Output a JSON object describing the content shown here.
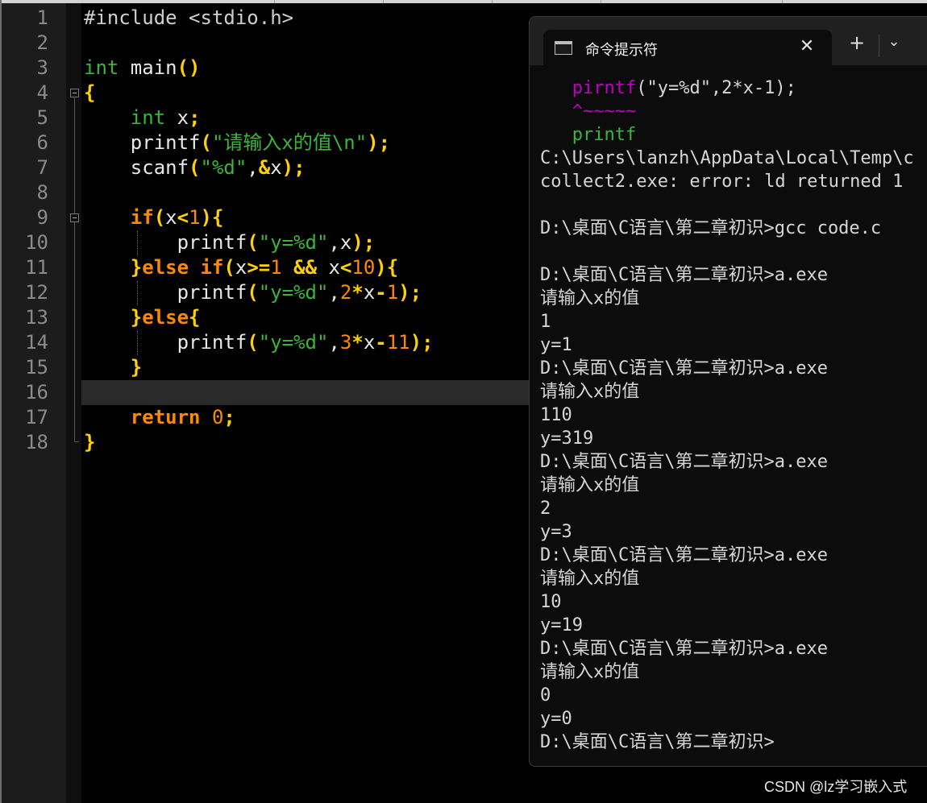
{
  "editor": {
    "lines": [
      {
        "n": "1",
        "tokens": [
          [
            "pp",
            "#include <stdio.h>"
          ]
        ]
      },
      {
        "n": "2",
        "tokens": []
      },
      {
        "n": "3",
        "tokens": [
          [
            "kw",
            "int"
          ],
          [
            "tx",
            " main"
          ],
          [
            "br",
            "()"
          ]
        ]
      },
      {
        "n": "4",
        "tokens": [
          [
            "br",
            "{"
          ]
        ]
      },
      {
        "n": "5",
        "tokens": [
          [
            "tx",
            "    "
          ],
          [
            "kw",
            "int"
          ],
          [
            "tx",
            " x"
          ],
          [
            "br",
            ";"
          ]
        ]
      },
      {
        "n": "6",
        "tokens": [
          [
            "tx",
            "    printf"
          ],
          [
            "br",
            "("
          ],
          [
            "st",
            "\"请输入x的值\\n\""
          ],
          [
            "br",
            ");"
          ]
        ]
      },
      {
        "n": "7",
        "tokens": [
          [
            "tx",
            "    scanf"
          ],
          [
            "br",
            "("
          ],
          [
            "st",
            "\"%d\""
          ],
          [
            "tx",
            ","
          ],
          [
            "br",
            "&"
          ],
          [
            "tx",
            "x"
          ],
          [
            "br",
            ");"
          ]
        ]
      },
      {
        "n": "8",
        "tokens": []
      },
      {
        "n": "9",
        "tokens": [
          [
            "tx",
            "    "
          ],
          [
            "kb",
            "if"
          ],
          [
            "br",
            "("
          ],
          [
            "tx",
            "x"
          ],
          [
            "br",
            "<"
          ],
          [
            "nm",
            "1"
          ],
          [
            "br",
            "){"
          ]
        ]
      },
      {
        "n": "10",
        "tokens": [
          [
            "tx",
            "        printf"
          ],
          [
            "br",
            "("
          ],
          [
            "st",
            "\"y=%d\""
          ],
          [
            "tx",
            ",x"
          ],
          [
            "br",
            ");"
          ]
        ]
      },
      {
        "n": "11",
        "tokens": [
          [
            "tx",
            "    "
          ],
          [
            "br",
            "}"
          ],
          [
            "kb",
            "else if"
          ],
          [
            "br",
            "("
          ],
          [
            "tx",
            "x"
          ],
          [
            "br",
            ">="
          ],
          [
            "nm",
            "1"
          ],
          [
            "tx",
            " "
          ],
          [
            "br",
            "&&"
          ],
          [
            "tx",
            " x"
          ],
          [
            "br",
            "<"
          ],
          [
            "nm",
            "10"
          ],
          [
            "br",
            "){"
          ]
        ]
      },
      {
        "n": "12",
        "tokens": [
          [
            "tx",
            "        printf"
          ],
          [
            "br",
            "("
          ],
          [
            "st",
            "\"y=%d\""
          ],
          [
            "tx",
            ","
          ],
          [
            "nm",
            "2"
          ],
          [
            "br",
            "*"
          ],
          [
            "tx",
            "x"
          ],
          [
            "br",
            "-"
          ],
          [
            "nm",
            "1"
          ],
          [
            "br",
            ");"
          ]
        ]
      },
      {
        "n": "13",
        "tokens": [
          [
            "tx",
            "    "
          ],
          [
            "br",
            "}"
          ],
          [
            "kb",
            "else"
          ],
          [
            "br",
            "{"
          ]
        ]
      },
      {
        "n": "14",
        "tokens": [
          [
            "tx",
            "        printf"
          ],
          [
            "br",
            "("
          ],
          [
            "st",
            "\"y=%d\""
          ],
          [
            "tx",
            ","
          ],
          [
            "nm",
            "3"
          ],
          [
            "br",
            "*"
          ],
          [
            "tx",
            "x"
          ],
          [
            "br",
            "-"
          ],
          [
            "nm",
            "11"
          ],
          [
            "br",
            ");"
          ]
        ]
      },
      {
        "n": "15",
        "tokens": [
          [
            "tx",
            "    "
          ],
          [
            "br",
            "}"
          ]
        ]
      },
      {
        "n": "16",
        "tokens": []
      },
      {
        "n": "17",
        "tokens": [
          [
            "tx",
            "    "
          ],
          [
            "kb",
            "return"
          ],
          [
            "tx",
            " "
          ],
          [
            "nm",
            "0"
          ],
          [
            "br",
            ";"
          ]
        ]
      },
      {
        "n": "18",
        "tokens": [
          [
            "br",
            "}"
          ]
        ]
      }
    ]
  },
  "terminal": {
    "tab_title": "命令提示符",
    "close_symbol": "✕",
    "plus_symbol": "+",
    "dropdown_symbol": "⌄",
    "lines": [
      [
        [
          "mag",
          "   pirntf"
        ],
        [
          "tx",
          "(\"y=%d\",2*x-1);"
        ]
      ],
      [
        [
          "mag",
          "   ^~~~~~"
        ]
      ],
      [
        [
          "grn",
          "   printf"
        ]
      ],
      [
        [
          "tx",
          "C:\\Users\\lanzh\\AppData\\Local\\Temp\\c"
        ]
      ],
      [
        [
          "tx",
          "collect2.exe: error: ld returned 1"
        ]
      ],
      [
        [
          "tx",
          ""
        ]
      ],
      [
        [
          "tx",
          "D:\\桌面\\C语言\\第二章初识>gcc code.c"
        ]
      ],
      [
        [
          "tx",
          ""
        ]
      ],
      [
        [
          "tx",
          "D:\\桌面\\C语言\\第二章初识>a.exe"
        ]
      ],
      [
        [
          "tx",
          "请输入x的值"
        ]
      ],
      [
        [
          "tx",
          "1"
        ]
      ],
      [
        [
          "tx",
          "y=1"
        ]
      ],
      [
        [
          "tx",
          "D:\\桌面\\C语言\\第二章初识>a.exe"
        ]
      ],
      [
        [
          "tx",
          "请输入x的值"
        ]
      ],
      [
        [
          "tx",
          "110"
        ]
      ],
      [
        [
          "tx",
          "y=319"
        ]
      ],
      [
        [
          "tx",
          "D:\\桌面\\C语言\\第二章初识>a.exe"
        ]
      ],
      [
        [
          "tx",
          "请输入x的值"
        ]
      ],
      [
        [
          "tx",
          "2"
        ]
      ],
      [
        [
          "tx",
          "y=3"
        ]
      ],
      [
        [
          "tx",
          "D:\\桌面\\C语言\\第二章初识>a.exe"
        ]
      ],
      [
        [
          "tx",
          "请输入x的值"
        ]
      ],
      [
        [
          "tx",
          "10"
        ]
      ],
      [
        [
          "tx",
          "y=19"
        ]
      ],
      [
        [
          "tx",
          "D:\\桌面\\C语言\\第二章初识>a.exe"
        ]
      ],
      [
        [
          "tx",
          "请输入x的值"
        ]
      ],
      [
        [
          "tx",
          "0"
        ]
      ],
      [
        [
          "tx",
          "y=0"
        ]
      ],
      [
        [
          "tx",
          "D:\\桌面\\C语言\\第二章初识>"
        ]
      ]
    ]
  },
  "watermark": "CSDN @lz学习嵌入式",
  "colors": {
    "editor_bg": "#000000",
    "gutter_bg": "#1c1c1c",
    "keyword_type": "#3ab53a",
    "keyword_control": "#ff8a00",
    "bracket": "#ffd100",
    "string": "#3ab53a",
    "number": "#ff8a00",
    "terminal_bg": "#0c0c0c",
    "terminal_error": "#c000c0",
    "terminal_hint": "#3cb43c"
  }
}
